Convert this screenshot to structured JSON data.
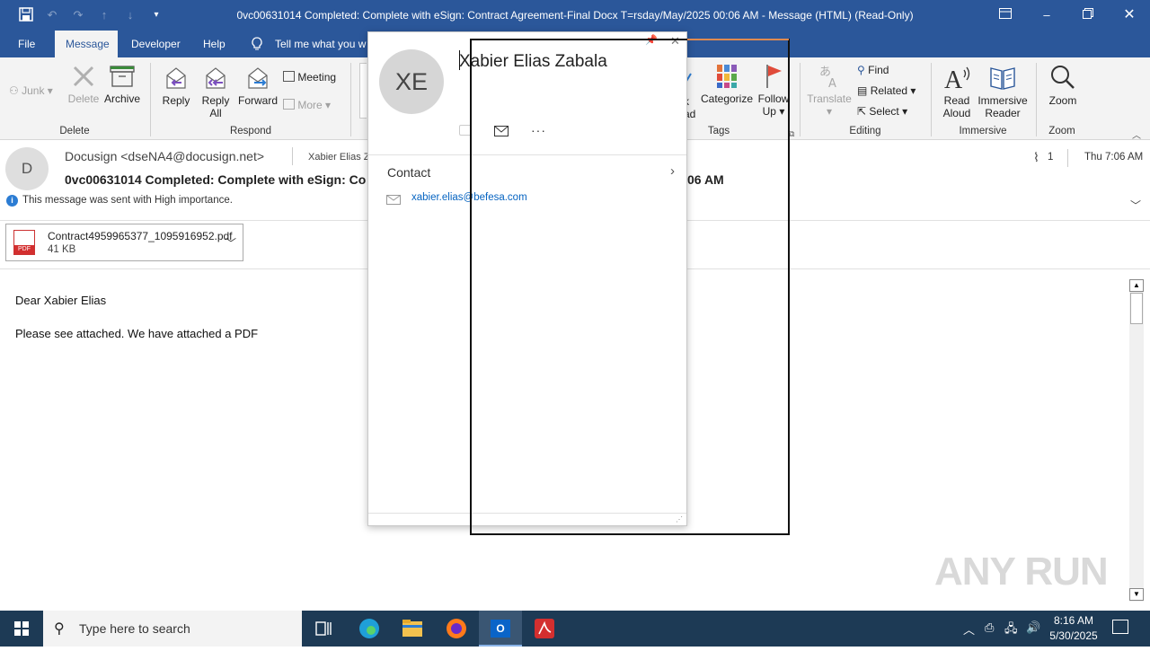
{
  "window": {
    "title": "0vc00631014 Completed: Complete with eSign: Contract Agreement-Final Docx T=rsday/May/2025 00:06 AM  -  Message (HTML) (Read-Only)"
  },
  "tabs": [
    {
      "label": "File"
    },
    {
      "label": "Message"
    },
    {
      "label": "Developer"
    },
    {
      "label": "Help"
    },
    {
      "label": "Tell me what you w"
    }
  ],
  "ribbon": {
    "junk": "Junk",
    "delete": "Delete",
    "archive": "Archive",
    "group_delete": "Delete",
    "reply": "Reply",
    "reply_all_1": "Reply",
    "reply_all_2": "All",
    "forward": "Forward",
    "meeting": "Meeting",
    "more": "More",
    "group_respond": "Respond",
    "mark_unread_1": "k",
    "mark_unread_2": "ad",
    "categorize": "Categorize",
    "follow_up_1": "Follow",
    "follow_up_2": "Up",
    "group_tags": "Tags",
    "translate": "Translate",
    "find": "Find",
    "related": "Related",
    "select": "Select",
    "group_editing": "Editing",
    "read_aloud_1": "Read",
    "read_aloud_2": "Aloud",
    "immersive_1": "Immersive",
    "immersive_2": "Reader",
    "group_immersive": "Immersive",
    "zoom": "Zoom",
    "group_zoom": "Zoom"
  },
  "message": {
    "sender_initial": "D",
    "from": "Docusign <dseNA4@docusign.net>",
    "to_partial": "Xabier Elias Z",
    "subject": "0vc00631014 Completed: Complete with eSign: Co",
    "subject_tail": "06 AM",
    "importance": "This message was sent with High importance.",
    "attachment_count": "1",
    "date": "Thu 7:06 AM",
    "attachment": {
      "name": "Contract4959965377_1095916952.pdf",
      "size": "41 KB",
      "icon_label": "PDF"
    },
    "body": [
      "Dear Xabier Elias",
      "Please see attached. We have attached a PDF"
    ]
  },
  "contact_card": {
    "initials": "XE",
    "name": "Xabier Elias Zabala",
    "section": "Contact",
    "email": "xabier.elias@befesa.com"
  },
  "watermark": "ANY RUN",
  "taskbar": {
    "search_placeholder": "Type here to search",
    "time": "8:16 AM",
    "date": "5/30/2025",
    "outlook_label": "O"
  },
  "colors": {
    "titlebar": "#2b579a",
    "accent": "#2b579a",
    "link": "#0563c1",
    "taskbar": "#1d3a55",
    "flag": "#e04b3a"
  }
}
